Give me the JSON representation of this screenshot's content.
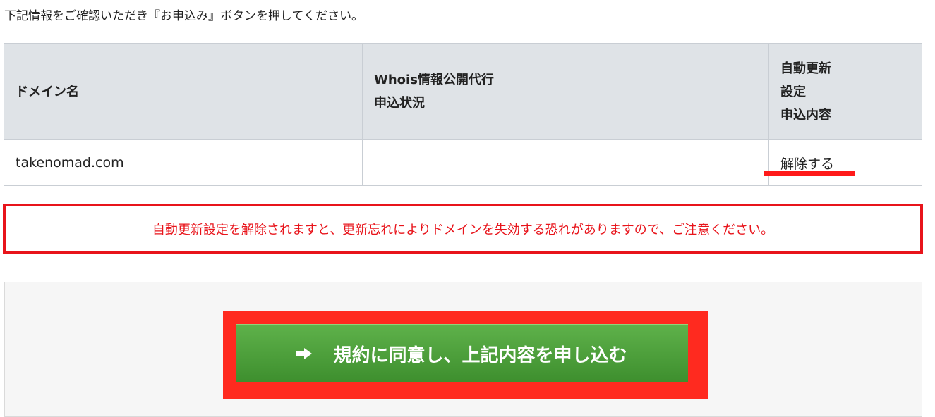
{
  "intro_text": "下記情報をご確認いただき『お申込み』ボタンを押してください。",
  "table": {
    "headers": {
      "domain": "ドメイン名",
      "whois_line1": "Whois情報公開代行",
      "whois_line2": "申込状況",
      "renew_line1": "自動更新",
      "renew_line2": "設定",
      "renew_line3": "申込内容"
    },
    "row": {
      "domain": "takenomad.com",
      "whois_status": "",
      "auto_renew": "解除する"
    }
  },
  "warning_text": "自動更新設定を解除されますと、更新忘れによりドメインを失効する恐れがありますので、ご注意ください。",
  "apply_button": {
    "label": "規約に同意し、上記内容を申し込む",
    "icon": "arrow-right-icon"
  },
  "colors": {
    "warning": "#e8141b",
    "highlight": "#ff2a1f",
    "button_green": "#4a9e3a",
    "header_bg": "#dfe3e7"
  }
}
